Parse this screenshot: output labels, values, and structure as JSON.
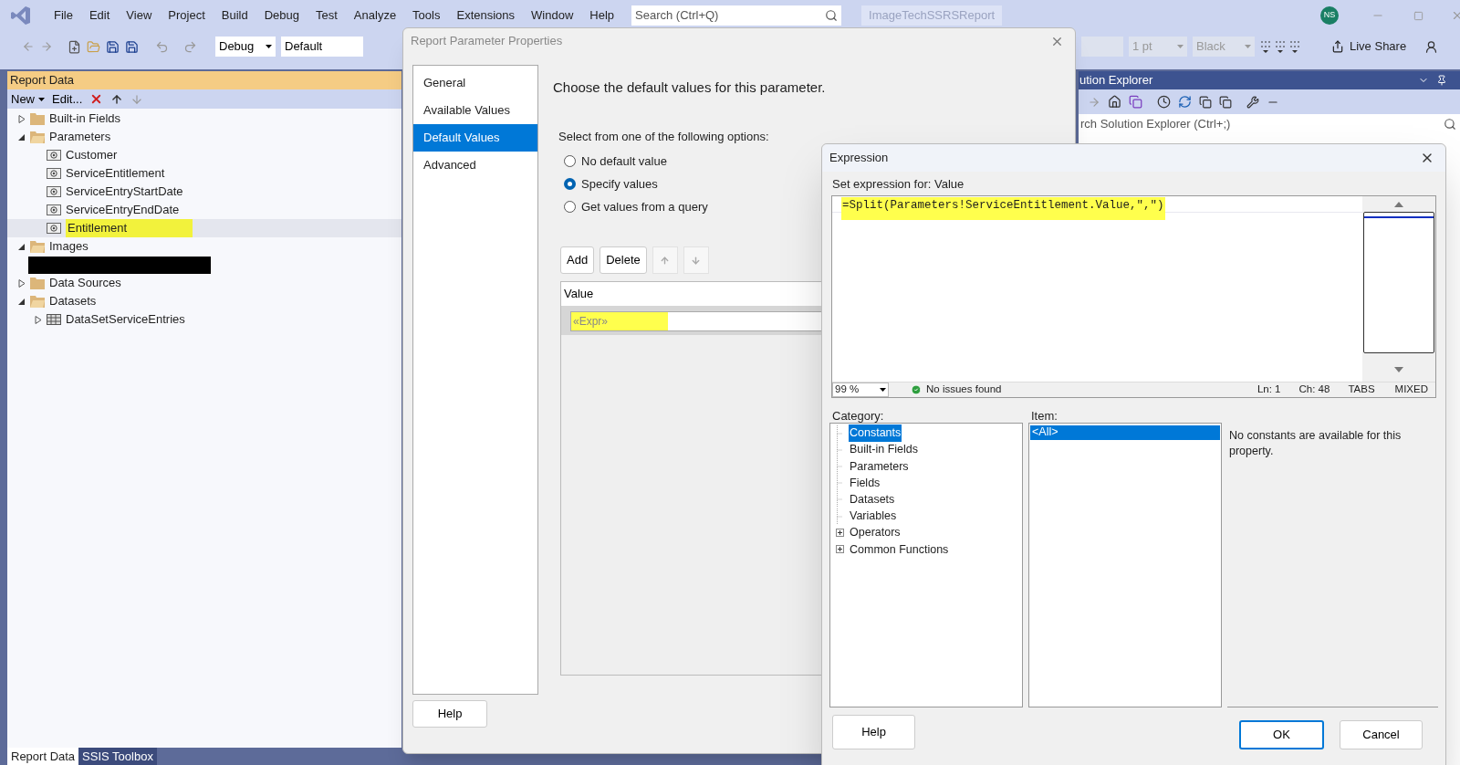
{
  "title_bar": {
    "menu": [
      "File",
      "Edit",
      "View",
      "Project",
      "Build",
      "Debug",
      "Test",
      "Analyze",
      "Tools",
      "Extensions",
      "Window",
      "Help"
    ],
    "search_placeholder": "Search (Ctrl+Q)",
    "solution_name": "ImageTechSSRSReport",
    "avatar": "NS"
  },
  "toolbar": {
    "configuration": "Debug",
    "platform": "Default",
    "size": "1 pt",
    "font_color": "Black",
    "live_share": "Live Share"
  },
  "report_data": {
    "title": "Report Data",
    "new": "New",
    "edit": "Edit...",
    "tree": [
      {
        "kind": "folder",
        "label": "Built-in Fields",
        "expanded": false,
        "selected": false
      },
      {
        "kind": "folder",
        "label": "Parameters",
        "expanded": true,
        "selected": false,
        "children": [
          {
            "kind": "param",
            "label": "Customer",
            "selected": false
          },
          {
            "kind": "param",
            "label": "ServiceEntitlement",
            "selected": false
          },
          {
            "kind": "param",
            "label": "ServiceEntryStartDate",
            "selected": false
          },
          {
            "kind": "param",
            "label": "ServiceEntryEndDate",
            "selected": false
          },
          {
            "kind": "param",
            "label": "Entitlement",
            "selected": true
          }
        ]
      },
      {
        "kind": "folder",
        "label": "Images",
        "expanded": true,
        "selected": false,
        "children": [
          {
            "kind": "redacted",
            "selected": false
          }
        ]
      },
      {
        "kind": "folder",
        "label": "Data Sources",
        "expanded": false,
        "selected": false
      },
      {
        "kind": "folder",
        "label": "Datasets",
        "expanded": true,
        "selected": false,
        "children": [
          {
            "kind": "dataset",
            "label": "DataSetServiceEntries",
            "expanded": false,
            "selected": false
          }
        ]
      }
    ],
    "tabs": [
      {
        "label": "Report Data",
        "selected": true
      },
      {
        "label": "SSIS Toolbox",
        "selected": false
      }
    ]
  },
  "solution_explorer": {
    "title": "ution Explorer",
    "search_placeholder": "rch Solution Explorer (Ctrl+;)"
  },
  "parameter_dialog": {
    "title": "Report Parameter Properties",
    "nav": [
      {
        "label": "General",
        "selected": false
      },
      {
        "label": "Available Values",
        "selected": false
      },
      {
        "label": "Default Values",
        "selected": true
      },
      {
        "label": "Advanced",
        "selected": false
      }
    ],
    "heading": "Choose the default values for this parameter.",
    "options_label": "Select from one of the following options:",
    "options": [
      {
        "label": "No default value",
        "selected": false
      },
      {
        "label": "Specify values",
        "selected": true
      },
      {
        "label": "Get values from a query",
        "selected": false
      }
    ],
    "add": "Add",
    "delete": "Delete",
    "value_header": "Value",
    "values": [
      "«Expr»"
    ],
    "help": "Help"
  },
  "expression_dialog": {
    "title": "Expression",
    "label": "Set expression for: Value",
    "expression": "=Split(Parameters!ServiceEntitlement.Value,\",\")",
    "zoom": "99 %",
    "status": "No issues found",
    "ln": "Ln: 1",
    "ch": "Ch: 48",
    "tabs": "TABS",
    "mixed": "MIXED",
    "category_label": "Category:",
    "categories": [
      {
        "label": "Constants",
        "selected": true,
        "expandable": false
      },
      {
        "label": "Built-in Fields",
        "selected": false,
        "expandable": false
      },
      {
        "label": "Parameters",
        "selected": false,
        "expandable": false
      },
      {
        "label": "Fields",
        "selected": false,
        "expandable": false
      },
      {
        "label": "Datasets",
        "selected": false,
        "expandable": false
      },
      {
        "label": "Variables",
        "selected": false,
        "expandable": false
      },
      {
        "label": "Operators",
        "selected": false,
        "expandable": true
      },
      {
        "label": "Common Functions",
        "selected": false,
        "expandable": true
      }
    ],
    "item_label": "Item:",
    "items": [
      {
        "label": "<All>",
        "selected": true
      }
    ],
    "description": "No constants are available for this property.",
    "help": "Help",
    "ok": "OK",
    "cancel": "Cancel"
  }
}
